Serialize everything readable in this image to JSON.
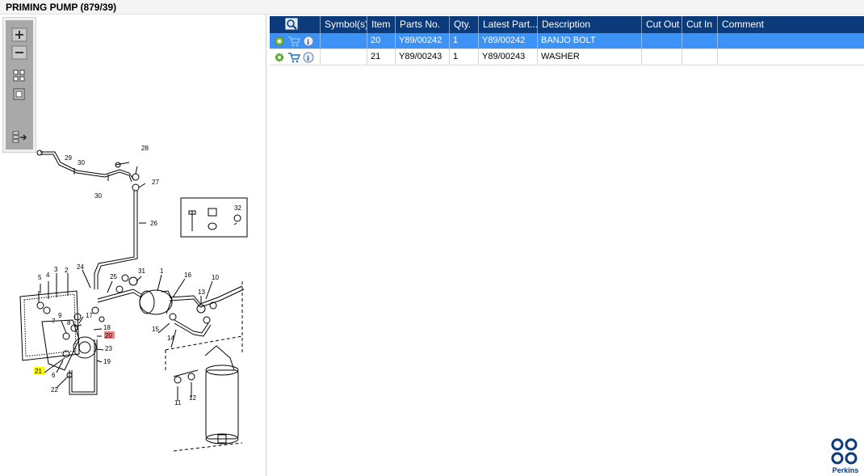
{
  "title": "PRIMING PUMP (879/39)",
  "toolbar": {
    "zoom_in": "zoom-in-icon",
    "zoom_out": "zoom-out-icon",
    "fit": "fit-view-icon",
    "actual": "actual-size-icon",
    "list": "list-export-icon"
  },
  "diagram": {
    "callouts": [
      "29",
      "30",
      "28",
      "27",
      "30",
      "26",
      "32",
      "24",
      "3",
      "2",
      "5",
      "4",
      "25",
      "31",
      "1",
      "16",
      "10",
      "9",
      "17",
      "13",
      "7",
      "8",
      "18",
      "20",
      "15",
      "14",
      "23",
      "21",
      "6",
      "19",
      "22",
      "11",
      "12"
    ],
    "highlighted": [
      "20",
      "21"
    ]
  },
  "table": {
    "headers": [
      "Symbol(s)",
      "Item",
      "Parts No.",
      "Qty.",
      "Latest Part...",
      "Description",
      "Cut Out",
      "Cut In",
      "Comment"
    ],
    "rows": [
      {
        "item": "20",
        "part_no": "Y89/00242",
        "qty": "1",
        "latest": "Y89/00242",
        "description": "BANJO BOLT",
        "cut_out": "",
        "cut_in": "",
        "comment": ""
      },
      {
        "item": "21",
        "part_no": "Y89/00243",
        "qty": "1",
        "latest": "Y89/00243",
        "description": "WASHER",
        "cut_out": "",
        "cut_in": "",
        "comment": ""
      }
    ]
  },
  "logo": {
    "text": "Perkins"
  },
  "colors": {
    "header_bg": "#0b3b7a",
    "selected_row": "#3d93f5",
    "highlight_yellow": "#ffff00",
    "highlight_red": "#f08080"
  }
}
